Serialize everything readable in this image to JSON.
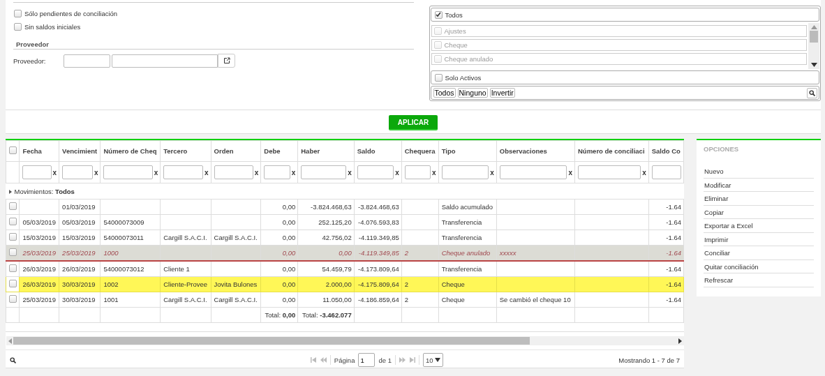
{
  "filters": {
    "options": [
      {
        "label": "Sólo pendientes de conciliación",
        "checked": false
      },
      {
        "label": "Sin saldos iniciales",
        "checked": false
      }
    ],
    "section_title": "Proveedor",
    "field_label": "Proveedor:"
  },
  "type_list": {
    "all": {
      "label": "Todos",
      "checked": true
    },
    "items": [
      {
        "label": "Ajustes",
        "checked": false,
        "disabled": true
      },
      {
        "label": "Cheque",
        "checked": false,
        "disabled": true
      },
      {
        "label": "Cheque anulado",
        "checked": false,
        "disabled": true
      }
    ],
    "active_only": {
      "label": "Solo Activos",
      "checked": false
    },
    "buttons": [
      "Todos",
      "Ninguno",
      "Invertir"
    ]
  },
  "apply_button": "APLICAR",
  "table": {
    "select_all": false,
    "columns": [
      {
        "label": "Fecha",
        "clear": "x"
      },
      {
        "label": "Vencimient",
        "clear": "x"
      },
      {
        "label": "Número de Cheq",
        "clear": "x"
      },
      {
        "label": "Tercero",
        "clear": "x"
      },
      {
        "label": "Orden",
        "clear": "x"
      },
      {
        "label": "Debe",
        "clear": "x"
      },
      {
        "label": "Haber",
        "clear": "x"
      },
      {
        "label": "Saldo",
        "clear": "x"
      },
      {
        "label": "Chequera",
        "clear": "x"
      },
      {
        "label": "Tipo",
        "clear": "x"
      },
      {
        "label": "Observaciones",
        "clear": "x"
      },
      {
        "label": "Número de conciliaci",
        "clear": "x"
      },
      {
        "label": "Saldo Co"
      }
    ],
    "group": "Movimientos: **Todos**",
    "rows": [
      {
        "checked": false,
        "selected": false,
        "annulled": false,
        "cells": [
          "",
          "01/03/2019",
          "",
          "",
          "",
          "0,00",
          "-3.824.468,63",
          "-3.824.468,63",
          "",
          "Saldo acumulado",
          "",
          "",
          "-1.64"
        ]
      },
      {
        "checked": false,
        "selected": false,
        "annulled": false,
        "cells": [
          "05/03/2019",
          "05/03/2019",
          "54000073009",
          "",
          "",
          "0,00",
          "252.125,20",
          "-4.076.593,83",
          "",
          "Transferencia",
          "",
          "",
          "-1.64"
        ]
      },
      {
        "checked": false,
        "selected": false,
        "annulled": false,
        "cells": [
          "15/03/2019",
          "15/03/2019",
          "54000073011",
          "Cargill S.A.C.I.",
          "Cargill S.A.C.I.",
          "0,00",
          "42.756,02",
          "-4.119.349,85",
          "",
          "Transferencia",
          "",
          "",
          "-1.64"
        ]
      },
      {
        "checked": false,
        "selected": false,
        "annulled": true,
        "cells": [
          "25/03/2019",
          "25/03/2019",
          "1000",
          "",
          "",
          "0,00",
          "0,00",
          "-4.119.349,85",
          "2",
          "Cheque anulado",
          "xxxxx",
          "",
          "-1.64"
        ]
      },
      {
        "checked": false,
        "selected": false,
        "annulled": false,
        "cells": [
          "26/03/2019",
          "26/03/2019",
          "54000073012",
          "Cliente 1",
          "",
          "0,00",
          "54.459,79",
          "-4.173.809,64",
          "",
          "Transferencia",
          "",
          "",
          "-1.64"
        ]
      },
      {
        "checked": false,
        "selected": true,
        "annulled": false,
        "cells": [
          "26/03/2019",
          "30/03/2019",
          "1002",
          "Cliente-Provee",
          "Jovita Bulones",
          "0,00",
          "2.000,00",
          "-4.175.809,64",
          "2",
          "Cheque",
          "",
          "",
          "-1.64"
        ]
      },
      {
        "checked": false,
        "selected": false,
        "annulled": false,
        "cells": [
          "25/03/2019",
          "30/03/2019",
          "1001",
          "Cargill S.A.C.I.",
          "Cargill S.A.C.I.",
          "0,00",
          "11.050,00",
          "-4.186.859,64",
          "2",
          "Cheque",
          "Se cambió el cheque 10",
          "",
          "-1.64"
        ]
      }
    ],
    "totals": {
      "5": "Total: **0,00**",
      "6": "Total: **-3.462.077**"
    }
  },
  "pager": {
    "page_label": "Página",
    "page": "1",
    "of": "de 1",
    "page_size": "10",
    "summary": "Mostrando 1 - 7 de 7"
  },
  "options": {
    "title": "OPCIONES",
    "items": [
      "Nuevo",
      "Modificar",
      "Eliminar",
      "Copiar",
      "Exportar a Excel",
      "Imprimir",
      "Conciliar",
      "Quitar conciliación",
      "Refrescar"
    ]
  }
}
